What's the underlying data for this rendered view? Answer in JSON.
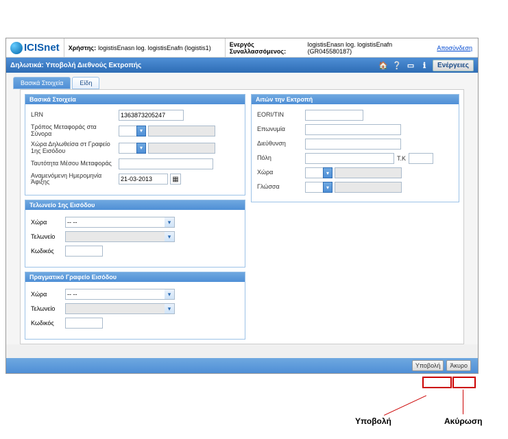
{
  "annotations": {
    "energies_label": "Ενέργειες",
    "ypovoli_label": "Υποβολή",
    "akyrosi_label": "Ακύρωση"
  },
  "header": {
    "logo_text": "ICISnet",
    "user_label": "Χρήστης:",
    "user_value": "logistisEnasn log. logistisEnafn (logistis1)",
    "active_label": "Ενεργός Συναλλασσόμενος:",
    "active_value": "logistisEnasn log. logistisEnafn (GR045580187)",
    "logout": "Αποσύνδεση"
  },
  "titlebar": {
    "title": "Δηλωτικά: Υποβολή Διεθνούς Εκτροπής",
    "actions_btn": "Ενέργειες"
  },
  "tabs": {
    "tab1": "Βασικά Στοιχεία",
    "tab2": "Είδη"
  },
  "panel_basic": {
    "heading": "Βασικά Στοιχεία",
    "lrn_label": "LRN",
    "lrn_value": "1363873205247",
    "transport_label": "Τρόπος Μεταφοράς στα Σύνορα",
    "country_decl_label": "Χώρα Δηλωθείσα στ Γραφείο 1ης Εισόδου",
    "transport_id_label": "Ταυτότητα Μέσου Μεταφοράς",
    "expected_date_label": "Αναμενόμενη Ημερομηνία Άφιξης",
    "expected_date_value": "21-03-2013"
  },
  "panel_applicant": {
    "heading": "Αιτών την Εκτροπή",
    "eori_label": "EORI/TIN",
    "name_label": "Επωνυμία",
    "address_label": "Διεύθυνση",
    "city_label": "Πόλη",
    "tk_label": "Τ.Κ",
    "country_label": "Χώρα",
    "lang_label": "Γλώσσα"
  },
  "panel_customs1": {
    "heading": "Τελωνείο 1ης Εισόδου",
    "country_label": "Χώρα",
    "country_value": "-- --",
    "customs_label": "Τελωνείο",
    "code_label": "Κωδικός"
  },
  "panel_customs2": {
    "heading": "Πραγματικό Γραφείο Εισόδου",
    "country_label": "Χώρα",
    "country_value": "-- --",
    "customs_label": "Τελωνείο",
    "code_label": "Κωδικός"
  },
  "footer": {
    "submit": "Υποβολή",
    "cancel": "Άκυρο"
  }
}
